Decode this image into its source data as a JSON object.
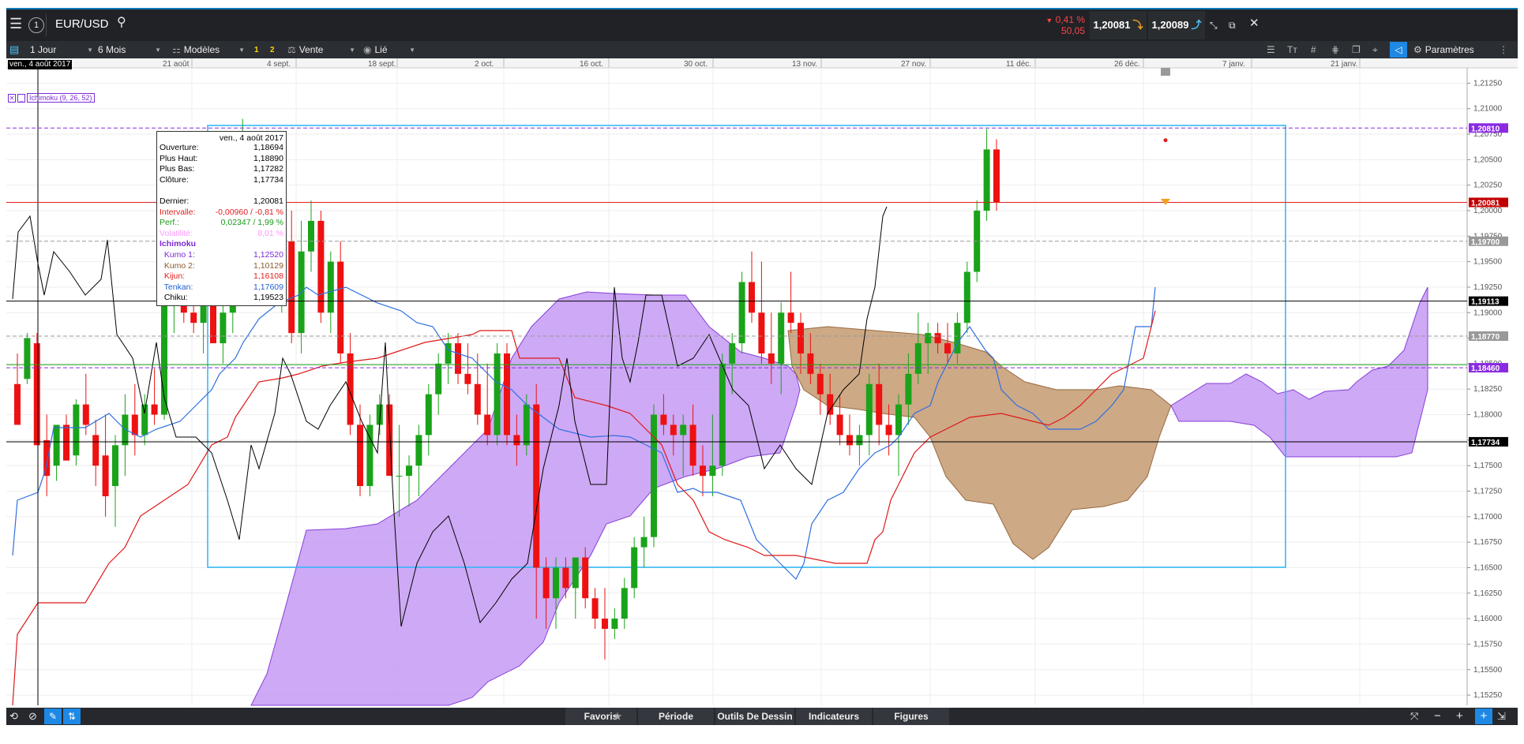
{
  "header": {
    "symbol": "EUR/USD",
    "change_pct": "0,41 %",
    "change_pts": "50,05",
    "sell_price": "1,20081",
    "buy_price": "1,20089"
  },
  "toolbar": {
    "interval": "1 Jour",
    "period": "6 Mois",
    "templates": "Modèles",
    "slot1": "1",
    "slot2": "2",
    "side": "Vente",
    "linked": "Lié",
    "settings": "Paramètres"
  },
  "chart_data": {
    "type": "candlestick",
    "instrument": "EUR/USD",
    "indicator_label": "Ichimoku (9, 26, 52)",
    "xlabels": [
      "21 août",
      "4 sept.",
      "18 sept.",
      "2 oct.",
      "16 oct.",
      "30 oct.",
      "13 nov.",
      "27 nov.",
      "11 déc.",
      "26 déc.",
      "7 janv.",
      "21 janv."
    ],
    "cursor_date": "ven., 4 août 2017",
    "ylabels": [
      "1,21250",
      "1,21000",
      "1,20750",
      "1,20500",
      "1,20250",
      "1,20000",
      "1,19750",
      "1,19500",
      "1,19250",
      "1,19000",
      "1,18750",
      "1,18500",
      "1,18250",
      "1,18000",
      "1,17750",
      "1,17500",
      "1,17250",
      "1,17000",
      "1,16750",
      "1,16500",
      "1,16250",
      "1,16000",
      "1,15750",
      "1,15500",
      "1,15250"
    ],
    "ylim": [
      1.1515,
      1.214
    ],
    "price_labels": [
      {
        "text": "1,20810",
        "value": 1.2081,
        "color": "#8a2be2"
      },
      {
        "text": "1,20081",
        "value": 1.20081,
        "color": "#c00000"
      },
      {
        "text": "1,19700",
        "value": 1.197,
        "color": "#999999"
      },
      {
        "text": "1,19113",
        "value": 1.19113,
        "color": "#000000"
      },
      {
        "text": "1,18770",
        "value": 1.1877,
        "color": "#999999"
      },
      {
        "text": "1,18460",
        "value": 1.1846,
        "color": "#8a2be2"
      },
      {
        "text": "1,17734",
        "value": 1.17734,
        "color": "#000000"
      }
    ]
  },
  "tooltip": {
    "date": "ven., 4 août 2017",
    "rows": [
      {
        "label": "Ouverture:",
        "value": "1,18694",
        "color": "#000"
      },
      {
        "label": "Plus Haut:",
        "value": "1,18890",
        "color": "#000"
      },
      {
        "label": "Plus Bas:",
        "value": "1,17282",
        "color": "#000"
      },
      {
        "label": "Clôture:",
        "value": "1,17734",
        "color": "#000"
      },
      {
        "label": "",
        "value": "",
        "color": "#000"
      },
      {
        "label": "Dernier:",
        "value": "1,20081",
        "color": "#000"
      },
      {
        "label": "Intervalle:",
        "value": "-0,00960 / -0,81 %",
        "color": "#e02020"
      },
      {
        "label": "Perf.:",
        "value": "0,02347 / 1,99 %",
        "color": "#1a9a1a"
      },
      {
        "label": "Volatilité:",
        "value": "8,01 %",
        "color": "#ff99ff"
      },
      {
        "label": "Ichimoku",
        "value": "",
        "color": "#7a2bd6"
      },
      {
        "label": "  Kumo 1:",
        "value": "1,12520",
        "color": "#7a2bd6"
      },
      {
        "label": "  Kumo 2:",
        "value": "1,10129",
        "color": "#8b5a2b"
      },
      {
        "label": "  Kijun:",
        "value": "1,16108",
        "color": "#e02020"
      },
      {
        "label": "  Tenkan:",
        "value": "1,17609",
        "color": "#2060d0"
      },
      {
        "label": "  Chiku:",
        "value": "1,19523",
        "color": "#000"
      }
    ]
  },
  "bottombar": {
    "favorites": "Favoris",
    "period": "Période",
    "drawing_tools": "Outils De Dessin",
    "indicators": "Indicateurs",
    "figures": "Figures"
  },
  "colors": {
    "up": "#1aa31a",
    "down": "#ee1111",
    "cloud_bull": "#c9a0f5",
    "cloud_bear": "#c8a07a",
    "tenkan": "#2f6fe0",
    "kijun": "#e01818",
    "chikou": "#000000",
    "selection": "#29b6f6"
  }
}
